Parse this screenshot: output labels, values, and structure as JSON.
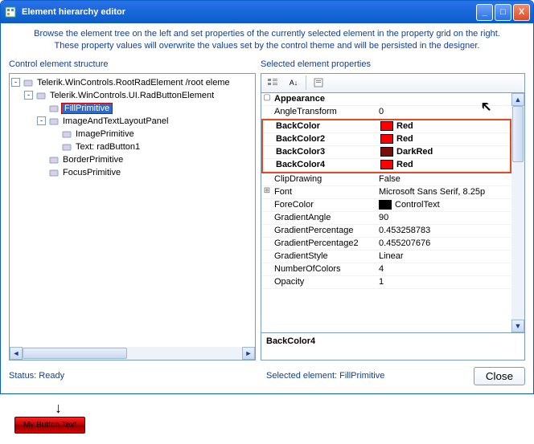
{
  "window": {
    "title": "Element hierarchy editor"
  },
  "description": {
    "line1": "Browse the element tree on the left and set properties of the currently selected element in the property grid on the right.",
    "line2": "These property values will overwrite the values set by the control theme and will be persisted in the designer."
  },
  "headers": {
    "tree": "Control element structure",
    "props": "Selected element properties"
  },
  "tree": {
    "items": [
      {
        "label": "Telerik.WinControls.RootRadElement /root eleme",
        "depth": 0,
        "exp": "-",
        "selected": false
      },
      {
        "label": "Telerik.WinControls.UI.RadButtonElement",
        "depth": 1,
        "exp": "-",
        "selected": false
      },
      {
        "label": "FillPrimitive",
        "depth": 2,
        "exp": "",
        "selected": true
      },
      {
        "label": "ImageAndTextLayoutPanel",
        "depth": 2,
        "exp": "-",
        "selected": false
      },
      {
        "label": "ImagePrimitive",
        "depth": 3,
        "exp": "",
        "selected": false
      },
      {
        "label": "Text: radButton1",
        "depth": 3,
        "exp": "",
        "selected": false
      },
      {
        "label": "BorderPrimitive",
        "depth": 2,
        "exp": "",
        "selected": false
      },
      {
        "label": "FocusPrimitive",
        "depth": 2,
        "exp": "",
        "selected": false
      }
    ]
  },
  "propgrid": {
    "category": "Appearance",
    "rows": [
      {
        "name": "AngleTransform",
        "value": "0",
        "bold": false,
        "swatch": null,
        "highlighted": false
      },
      {
        "name": "BackColor",
        "value": "Red",
        "bold": true,
        "swatch": "#ff0000",
        "highlighted": true
      },
      {
        "name": "BackColor2",
        "value": "Red",
        "bold": true,
        "swatch": "#ff0000",
        "highlighted": true
      },
      {
        "name": "BackColor3",
        "value": "DarkRed",
        "bold": true,
        "swatch": "#7a0c0c",
        "highlighted": true
      },
      {
        "name": "BackColor4",
        "value": "Red",
        "bold": true,
        "swatch": "#ff0000",
        "highlighted": true
      },
      {
        "name": "ClipDrawing",
        "value": "False",
        "bold": false,
        "swatch": null,
        "highlighted": false
      },
      {
        "name": "Font",
        "value": "Microsoft Sans Serif, 8.25p",
        "bold": false,
        "swatch": null,
        "highlighted": false,
        "expandable": true
      },
      {
        "name": "ForeColor",
        "value": "ControlText",
        "bold": false,
        "swatch": "#000000",
        "highlighted": false
      },
      {
        "name": "GradientAngle",
        "value": "90",
        "bold": false,
        "swatch": null,
        "highlighted": false
      },
      {
        "name": "GradientPercentage",
        "value": "0.453258783",
        "bold": false,
        "swatch": null,
        "highlighted": false
      },
      {
        "name": "GradientPercentage2",
        "value": "0.455207676",
        "bold": false,
        "swatch": null,
        "highlighted": false
      },
      {
        "name": "GradientStyle",
        "value": "Linear",
        "bold": false,
        "swatch": null,
        "highlighted": false
      },
      {
        "name": "NumberOfColors",
        "value": "4",
        "bold": false,
        "swatch": null,
        "highlighted": false
      },
      {
        "name": "Opacity",
        "value": "1",
        "bold": false,
        "swatch": null,
        "highlighted": false
      }
    ],
    "desc_name": "BackColor4"
  },
  "footer": {
    "status": "Status: Ready",
    "selected": "Selected element: FillPrimitive",
    "close": "Close"
  },
  "preview": {
    "button_text": "My Button Text"
  }
}
